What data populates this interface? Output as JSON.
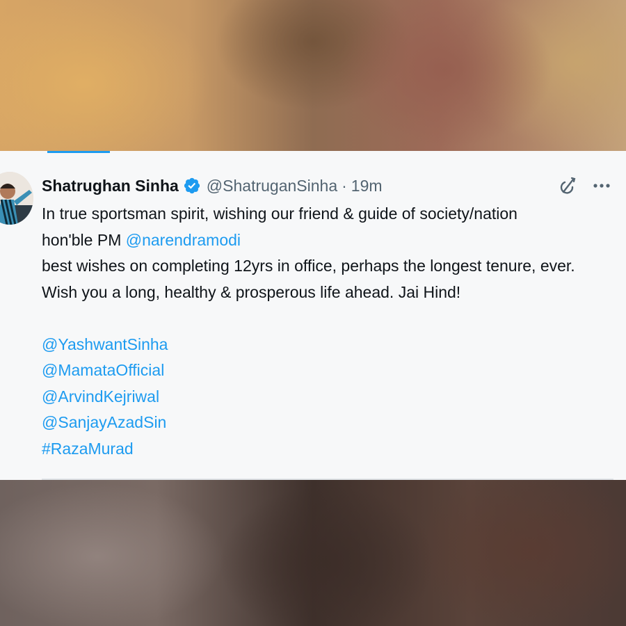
{
  "tweet": {
    "author_name": "Shatrughan Sinha",
    "handle": "@ShatruganSinha",
    "separator": "·",
    "time": "19m",
    "lines": [
      "In true sportsman spirit, wishing our friend & guide of society/nation",
      "hon'ble PM ",
      "best wishes on completing 12yrs in office, perhaps the longest tenure, ever.",
      "Wish you a long, healthy & prosperous life ahead. Jai Hind!"
    ],
    "inline_mention": "@narendramodi",
    "mentions": [
      "@YashwantSinha",
      "@MamataOfficial",
      "@ArvindKejriwal",
      "@SanjayAzadSin",
      "#RazaMurad"
    ]
  },
  "icons": {
    "verified": "verified-badge-icon",
    "grok": "grok-icon",
    "more": "more-icon",
    "avatar": "avatar"
  },
  "colors": {
    "link": "#1d9bf0",
    "text": "#0f1419",
    "muted": "#536471",
    "card_bg": "#f7f8f9"
  }
}
